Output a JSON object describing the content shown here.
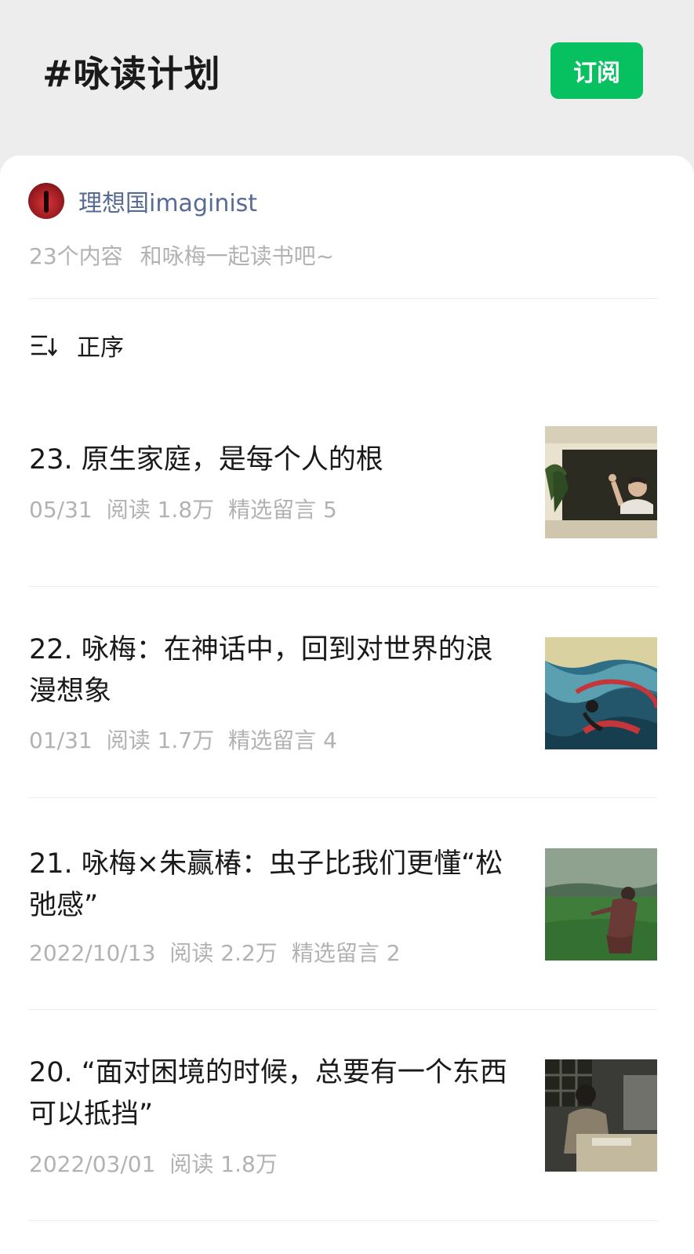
{
  "header": {
    "title": "#咏读计划",
    "subscribe_label": "订阅"
  },
  "account": {
    "name": "理想国imaginist",
    "count": "23个内容",
    "description": "和咏梅一起读书吧~"
  },
  "sort": {
    "label": "正序",
    "icon": "sort-order-icon"
  },
  "articles": [
    {
      "title": "23. 原生家庭，是每个人的根",
      "date": "05/31",
      "reads": "阅读 1.8万",
      "comments": "精选留言 5",
      "thumb": "woman-waving-window-photo"
    },
    {
      "title": "22. 咏梅：在神话中，回到对世界的浪漫想象",
      "date": "01/31",
      "reads": "阅读 1.7万",
      "comments": "精选留言 4",
      "thumb": "mythical-waves-painting"
    },
    {
      "title": "21. 咏梅×朱赢椿：虫子比我们更懂“松弛感”",
      "date": "2022/10/13",
      "reads": "阅读 2.2万",
      "comments": "精选留言 2",
      "thumb": "woman-in-green-field-photo"
    },
    {
      "title": "20. “面对困境的时候，总要有一个东西可以抵挡”",
      "date": "2022/03/01",
      "reads": "阅读 1.8万",
      "comments": "",
      "thumb": "woman-at-desk-photo"
    }
  ]
}
